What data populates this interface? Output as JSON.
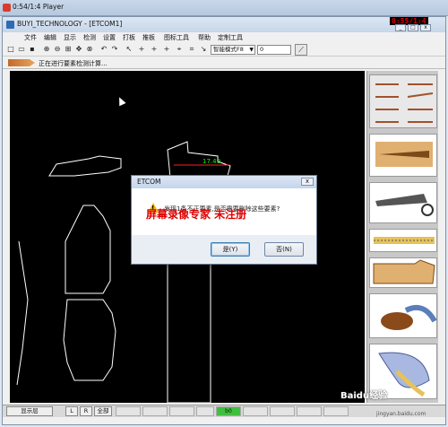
{
  "player": {
    "title": "0:54/1:4 Player"
  },
  "app": {
    "title": "BUYI_TECHNOLOGY - [ETCOM1]",
    "recording_time": "0:55/1:4",
    "menus": [
      "文件",
      "编辑",
      "显示",
      "检测",
      "设置",
      "打板",
      "推板",
      "图标工具",
      "帮助",
      "定制工具"
    ]
  },
  "toolbar": {
    "mode_select": "智能模式F8",
    "value_input": "0"
  },
  "status": {
    "text": "正在进行要素检测计算..."
  },
  "canvas": {
    "dimension_label": "17.49"
  },
  "dialog": {
    "title": "ETCOM",
    "message": "发现1条不正要素,是否需要删除这些要素?",
    "watermark": "屏幕录像专家 未注册",
    "yes_label": "是(Y)",
    "no_label": "否(N)"
  },
  "bottombar": {
    "layer_label": "显示层",
    "l_label": "L",
    "r_label": "R",
    "all_label": "全部",
    "cell_value": "b0"
  },
  "branding": {
    "logo": "Baidu经验",
    "url": "jingyan.baidu.com"
  },
  "colors": {
    "canvas_bg": "#000000",
    "dimension": "#00ff00",
    "measure_line": "#ff0000",
    "watermark": "#e00000"
  }
}
